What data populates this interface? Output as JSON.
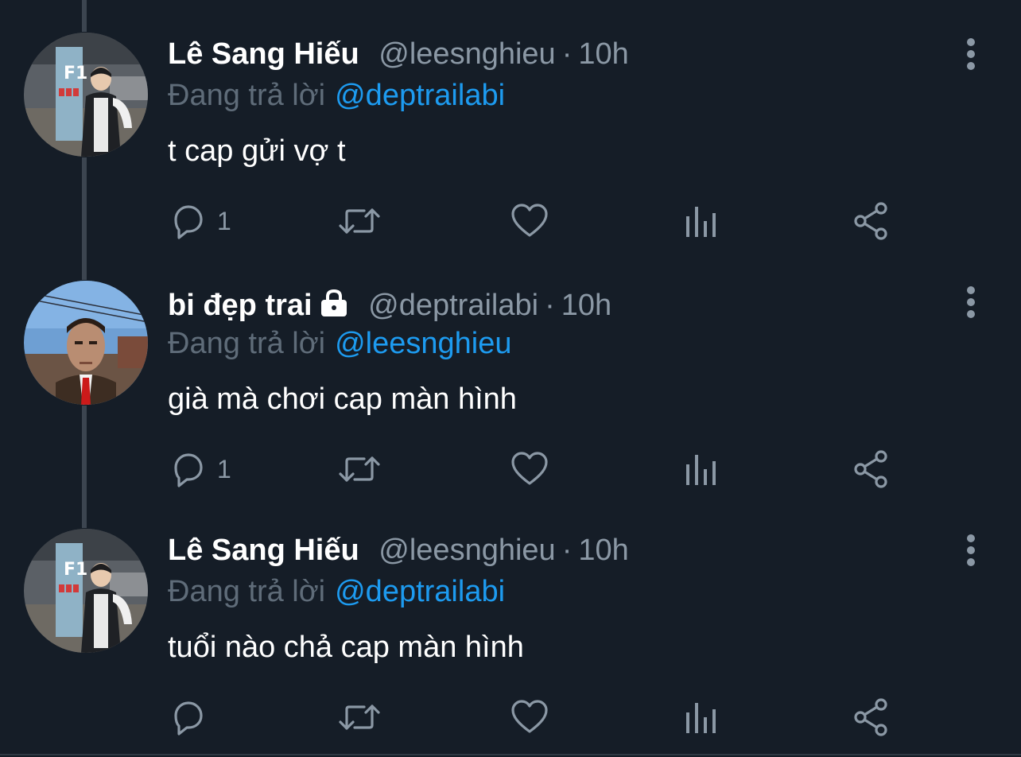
{
  "thread": {
    "tweets": [
      {
        "display_name": "Lê Sang Hiếu",
        "locked": false,
        "handle": "@leesnghieu",
        "separator": "·",
        "time": "10h",
        "reply_label": "Đang trả lời",
        "reply_to": "@deptrailabi",
        "text": "t cap gửi vợ t",
        "reply_count": "1",
        "avatar_icon": "user-avatar-leesnghieu"
      },
      {
        "display_name": "bi đẹp trai",
        "locked": true,
        "handle": "@deptrailabi",
        "separator": "·",
        "time": "10h",
        "reply_label": "Đang trả lời",
        "reply_to": "@leesnghieu",
        "text": "già mà chơi cap màn hình",
        "reply_count": "1",
        "avatar_icon": "user-avatar-deptrailabi"
      },
      {
        "display_name": "Lê Sang Hiếu",
        "locked": false,
        "handle": "@leesnghieu",
        "separator": "·",
        "time": "10h",
        "reply_label": "Đang trả lời",
        "reply_to": "@deptrailabi",
        "text": "tuổi nào chả cap màn hình",
        "reply_count": "",
        "avatar_icon": "user-avatar-leesnghieu"
      }
    ]
  },
  "icons": {
    "reply": "speech-bubble-icon",
    "retweet": "retweet-icon",
    "like": "heart-icon",
    "analytics": "bar-chart-icon",
    "share": "share-icon",
    "more": "vertical-ellipsis-icon",
    "lock": "lock-icon"
  },
  "colors": {
    "background": "#151d27",
    "text_primary": "#ffffff",
    "text_secondary": "#8b98a5",
    "reply_label": "#5f6c79",
    "mention": "#1d9bf0",
    "icon": "#8b98a5",
    "thread_line": "#3c4550"
  }
}
